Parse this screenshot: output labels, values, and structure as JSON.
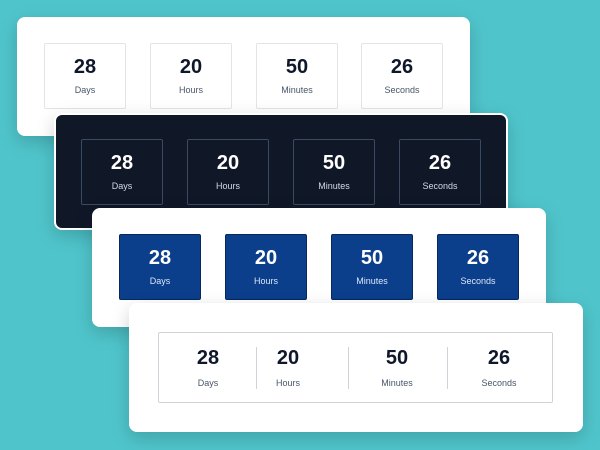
{
  "countdowns": [
    {
      "style": "light-outline",
      "units": [
        {
          "value": "28",
          "label": "Days"
        },
        {
          "value": "20",
          "label": "Hours"
        },
        {
          "value": "50",
          "label": "Minutes"
        },
        {
          "value": "26",
          "label": "Seconds"
        }
      ]
    },
    {
      "style": "dark-outline",
      "units": [
        {
          "value": "28",
          "label": "Days"
        },
        {
          "value": "20",
          "label": "Hours"
        },
        {
          "value": "50",
          "label": "Minutes"
        },
        {
          "value": "26",
          "label": "Seconds"
        }
      ]
    },
    {
      "style": "blue-filled",
      "units": [
        {
          "value": "28",
          "label": "Days"
        },
        {
          "value": "20",
          "label": "Hours"
        },
        {
          "value": "50",
          "label": "Minutes"
        },
        {
          "value": "26",
          "label": "Seconds"
        }
      ]
    },
    {
      "style": "divided-bar",
      "units": [
        {
          "value": "28",
          "label": "Days"
        },
        {
          "value": "20",
          "label": "Hours"
        },
        {
          "value": "50",
          "label": "Minutes"
        },
        {
          "value": "26",
          "label": "Seconds"
        }
      ]
    }
  ],
  "colors": {
    "background": "#4fc5cb",
    "dark_card": "#101828",
    "blue_box": "#0b3f8c",
    "text_dark": "#0f172a"
  }
}
